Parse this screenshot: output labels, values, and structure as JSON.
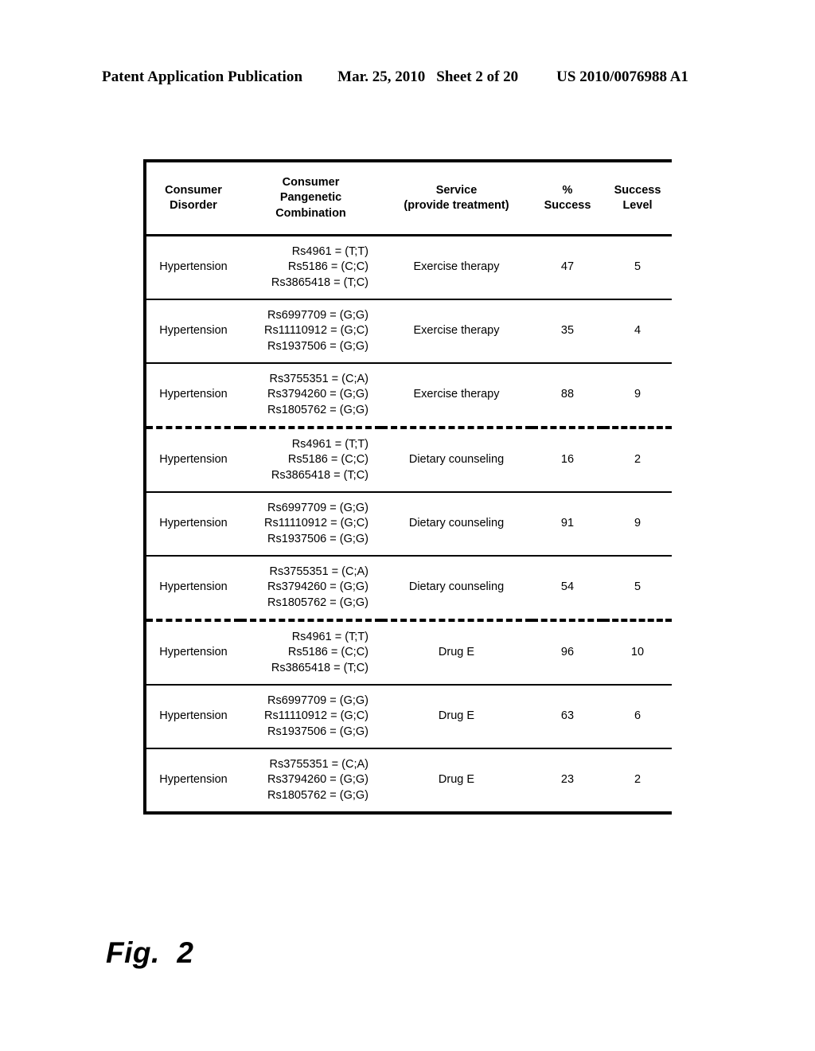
{
  "page_header": {
    "publication": "Patent Application Publication",
    "date": "Mar. 25, 2010",
    "sheet": "Sheet 2 of 20",
    "patent_number": "US 2010/0076988 A1"
  },
  "figure": {
    "caption": "Fig.  2"
  },
  "table": {
    "columns": [
      "Consumer\nDisorder",
      "Consumer\nPangenetic\nCombination",
      "Service\n(provide treatment)",
      "%\nSuccess",
      "Success\nLevel"
    ],
    "rows": [
      {
        "disorder": "Hypertension",
        "combination": "Rs4961 = (T;T)\nRs5186 = (C;C)\nRs3865418 = (T;C)",
        "service": "Exercise therapy",
        "pct_success": "47",
        "success_level": "5",
        "group_start": false
      },
      {
        "disorder": "Hypertension",
        "combination": "Rs6997709 = (G;G)\nRs11110912 = (G;C)\nRs1937506 = (G;G)",
        "service": "Exercise therapy",
        "pct_success": "35",
        "success_level": "4",
        "group_start": false
      },
      {
        "disorder": "Hypertension",
        "combination": "Rs3755351 = (C;A)\nRs3794260 = (G;G)\nRs1805762 = (G;G)",
        "service": "Exercise therapy",
        "pct_success": "88",
        "success_level": "9",
        "group_start": false
      },
      {
        "disorder": "Hypertension",
        "combination": "Rs4961 = (T;T)\nRs5186 = (C;C)\nRs3865418 = (T;C)",
        "service": "Dietary counseling",
        "pct_success": "16",
        "success_level": "2",
        "group_start": true
      },
      {
        "disorder": "Hypertension",
        "combination": "Rs6997709 = (G;G)\nRs11110912 = (G;C)\nRs1937506 = (G;G)",
        "service": "Dietary counseling",
        "pct_success": "91",
        "success_level": "9",
        "group_start": false
      },
      {
        "disorder": "Hypertension",
        "combination": "Rs3755351 = (C;A)\nRs3794260 = (G;G)\nRs1805762 = (G;G)",
        "service": "Dietary counseling",
        "pct_success": "54",
        "success_level": "5",
        "group_start": false
      },
      {
        "disorder": "Hypertension",
        "combination": "Rs4961 = (T;T)\nRs5186 = (C;C)\nRs3865418 = (T;C)",
        "service": "Drug E",
        "pct_success": "96",
        "success_level": "10",
        "group_start": true
      },
      {
        "disorder": "Hypertension",
        "combination": "Rs6997709 = (G;G)\nRs11110912 = (G;C)\nRs1937506 = (G;G)",
        "service": "Drug E",
        "pct_success": "63",
        "success_level": "6",
        "group_start": false
      },
      {
        "disorder": "Hypertension",
        "combination": "Rs3755351 = (C;A)\nRs3794260 = (G;G)\nRs1805762 = (G;G)",
        "service": "Drug E",
        "pct_success": "23",
        "success_level": "2",
        "group_start": false
      }
    ]
  }
}
